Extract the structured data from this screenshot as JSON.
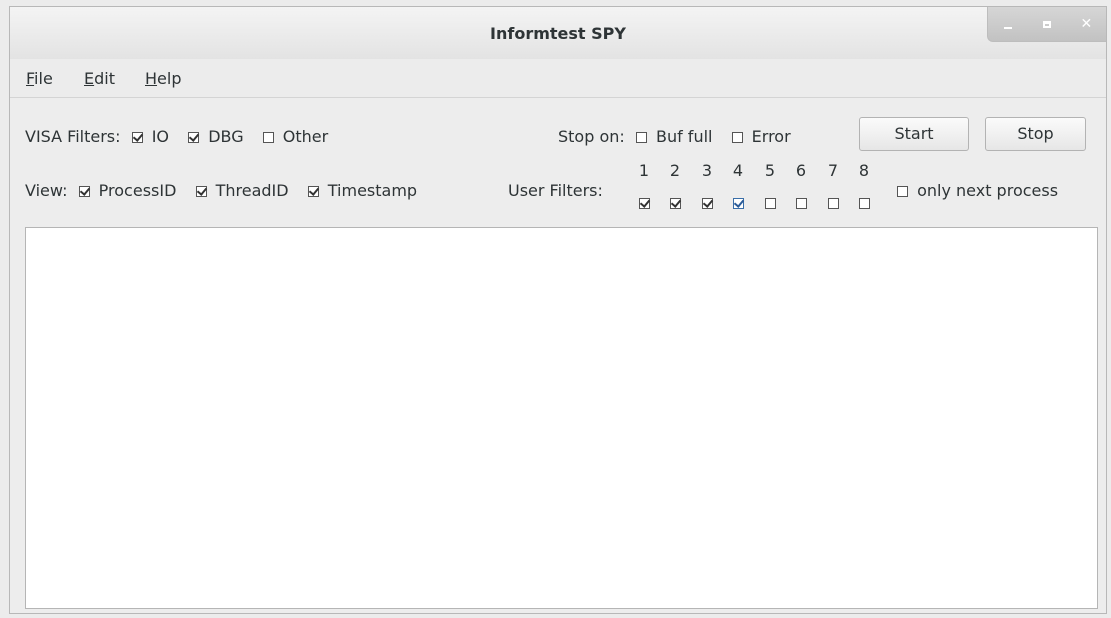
{
  "window": {
    "title": "Informtest SPY"
  },
  "wm": {
    "minimize_icon": "minimize-icon",
    "maximize_icon": "maximize-icon",
    "close_glyph": "✕"
  },
  "menu": {
    "file_first": "F",
    "file_rest": "ile",
    "edit_first": "E",
    "edit_rest": "dit",
    "help_first": "H",
    "help_rest": "elp"
  },
  "visa": {
    "label": "VISA Filters:",
    "io": {
      "label": "IO",
      "checked": true
    },
    "dbg": {
      "label": "DBG",
      "checked": true
    },
    "other": {
      "label": "Other",
      "checked": false
    }
  },
  "stop_on": {
    "label": "Stop on:",
    "buf_full": {
      "label": "Buf full",
      "checked": false
    },
    "error": {
      "label": "Error",
      "checked": false
    }
  },
  "buttons": {
    "start": "Start",
    "stop": "Stop"
  },
  "view": {
    "label": "View:",
    "process_id": {
      "label": "ProcessID",
      "checked": true
    },
    "thread_id": {
      "label": "ThreadID",
      "checked": true
    },
    "timestamp": {
      "label": "Timestamp",
      "checked": true
    }
  },
  "user_filters": {
    "label": "User Filters:",
    "items": [
      {
        "num": "1",
        "checked": true
      },
      {
        "num": "2",
        "checked": true
      },
      {
        "num": "3",
        "checked": true
      },
      {
        "num": "4",
        "checked": true
      },
      {
        "num": "5",
        "checked": false
      },
      {
        "num": "6",
        "checked": false
      },
      {
        "num": "7",
        "checked": false
      },
      {
        "num": "8",
        "checked": false
      }
    ]
  },
  "only_next_process": {
    "label": "only next process",
    "checked": false
  },
  "log": {
    "content": ""
  }
}
